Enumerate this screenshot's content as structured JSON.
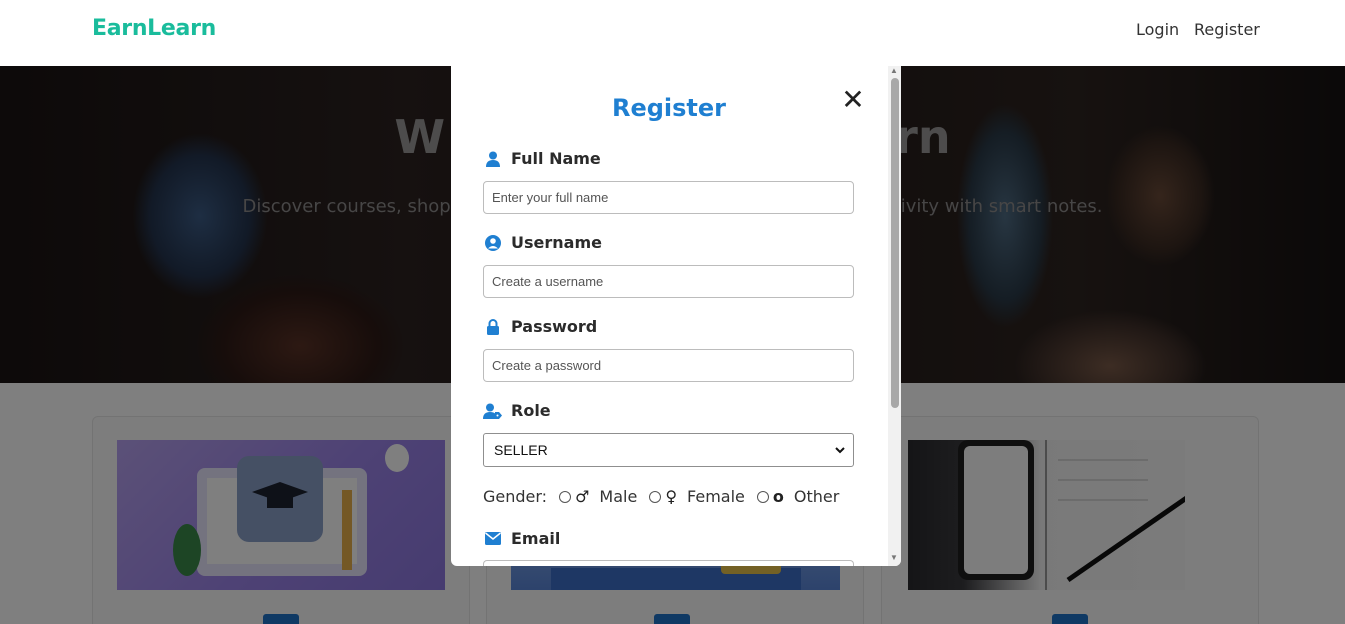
{
  "header": {
    "brand": "EarnLearn",
    "brand_color": "#1abc9c",
    "nav": {
      "login": "Login",
      "register": "Register"
    }
  },
  "hero": {
    "title_left": "W",
    "title_right": "rn",
    "subtitle_left": "Discover courses, shop",
    "subtitle_right": "ivity with smart notes."
  },
  "modal": {
    "title": "Register",
    "close_icon": "close-icon",
    "fields": {
      "full_name": {
        "label": "Full Name",
        "placeholder": "Enter your full name",
        "icon": "user-icon"
      },
      "username": {
        "label": "Username",
        "placeholder": "Create a username",
        "icon": "user-circle-icon"
      },
      "password": {
        "label": "Password",
        "placeholder": "Create a password",
        "icon": "lock-icon"
      },
      "role": {
        "label": "Role",
        "selected": "SELLER",
        "icon": "user-tag-icon"
      },
      "email": {
        "label": "Email",
        "icon": "envelope-icon"
      }
    },
    "gender": {
      "label": "Gender:",
      "options": [
        {
          "symbol": "♂",
          "label": "Male"
        },
        {
          "symbol": "♀",
          "label": "Female"
        },
        {
          "symbol": "o",
          "label": "Other"
        }
      ]
    },
    "accent": "#1f7fd1"
  }
}
